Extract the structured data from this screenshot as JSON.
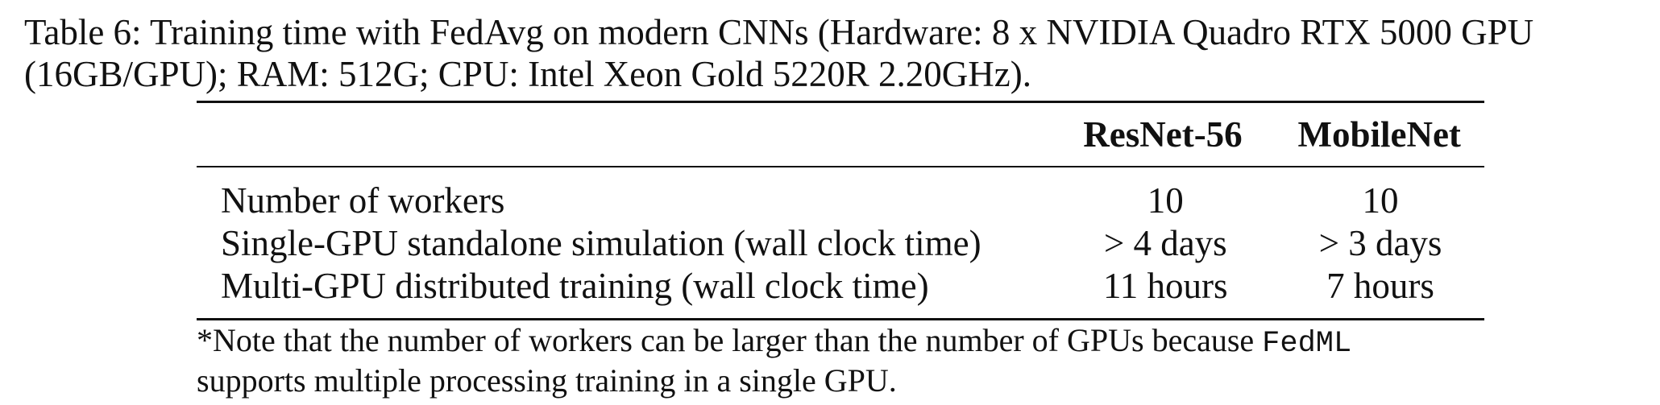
{
  "caption": "Table 6: Training time with FedAvg on modern CNNs (Hardware: 8 x NVIDIA Quadro RTX 5000 GPU (16GB/GPU); RAM: 512G; CPU: Intel Xeon Gold 5220R 2.20GHz).",
  "table": {
    "headers": [
      "",
      "ResNet-56",
      "MobileNet"
    ],
    "rows": [
      {
        "label": "Number of workers",
        "resnet": "10",
        "mobilenet": "10"
      },
      {
        "label": "Single-GPU standalone simulation (wall clock time)",
        "resnet": "> 4 days",
        "mobilenet": "> 3 days"
      },
      {
        "label": "Multi-GPU distributed training (wall clock time)",
        "resnet": "11 hours",
        "mobilenet": "7 hours"
      }
    ]
  },
  "note": {
    "before": " *Note that the number of workers can be larger than the number of GPUs because ",
    "code": "FedML",
    "after": "supports multiple processing training in a single GPU."
  }
}
